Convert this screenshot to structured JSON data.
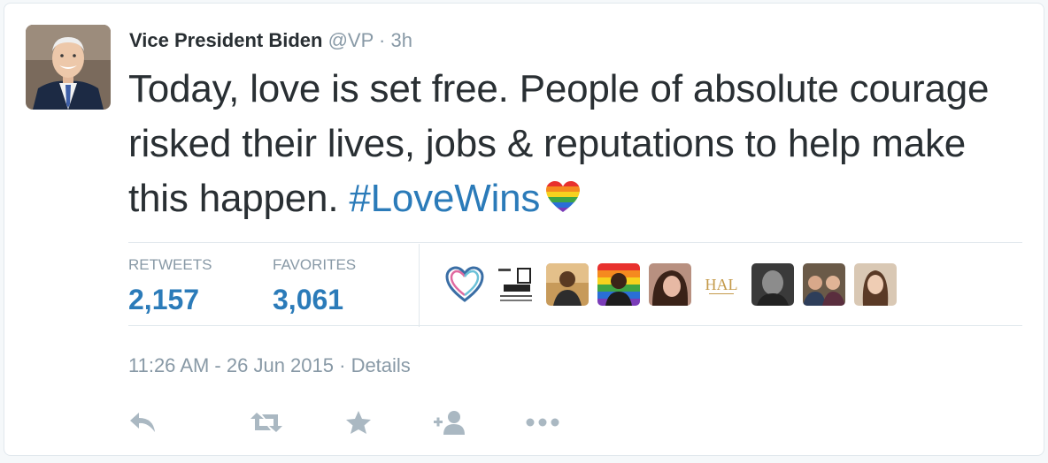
{
  "tweet": {
    "author_name": "Vice President Biden",
    "author_handle": "@VP",
    "separator": "·",
    "relative_time": "3h",
    "text_part1": "Today, love is set free. People of absolute courage risked their lives, jobs & reputations to help make this happen. ",
    "hashtag": "#LoveWins",
    "emoji_icon": "rainbow-heart-icon"
  },
  "stats": {
    "retweets_label": "RETWEETS",
    "retweets_value": "2,157",
    "favorites_label": "FAVORITES",
    "favorites_value": "3,061"
  },
  "favoriters": [
    "heart-logo-avatar",
    "business-card-avatar",
    "user-photo-avatar",
    "rainbow-photo-avatar",
    "user-photo-avatar",
    "hal-logo-avatar",
    "user-photo-avatar",
    "group-photo-avatar",
    "user-photo-avatar"
  ],
  "meta": {
    "timestamp": "11:26 AM - 26 Jun 2015",
    "separator": "·",
    "details_link": "Details"
  },
  "actions": {
    "reply_icon": "reply-icon",
    "retweet_icon": "retweet-icon",
    "favorite_icon": "star-icon",
    "follow_icon": "follow-icon",
    "more_icon": "more-icon"
  },
  "colors": {
    "text": "#292f33",
    "muted": "#8899a6",
    "link": "#2b7bb9",
    "border": "#e1e8ed",
    "icon": "#aab8c2"
  }
}
